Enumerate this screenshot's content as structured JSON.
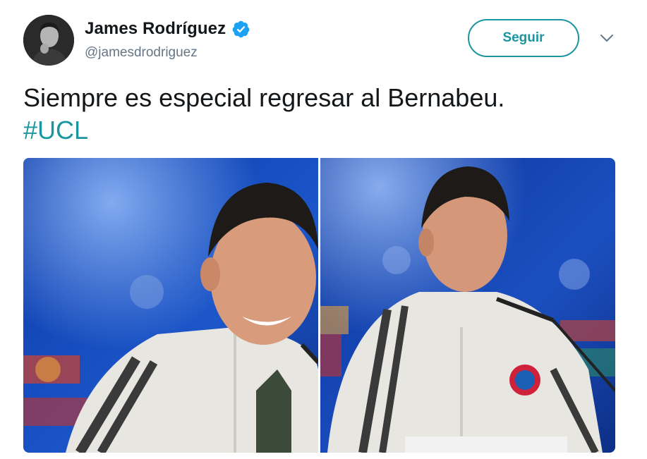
{
  "author": {
    "display_name": "James Rodríguez",
    "handle": "@jamesdrodriguez",
    "verified": true,
    "avatar_icon": "profile-photo"
  },
  "actions": {
    "follow_label": "Seguir",
    "more_icon": "chevron-down-icon"
  },
  "tweet": {
    "text": "Siempre es especial regresar al Bernabeu.",
    "hashtag": "#UCL"
  },
  "media": {
    "photos": [
      {
        "name": "photo-1",
        "description_icon": "press-conference-photo"
      },
      {
        "name": "photo-2",
        "description_icon": "press-conference-photo"
      }
    ]
  },
  "colors": {
    "accent": "#1b95a0",
    "verified": "#1da1f2",
    "secondary_text": "#657786",
    "primary_text": "#14171a"
  }
}
